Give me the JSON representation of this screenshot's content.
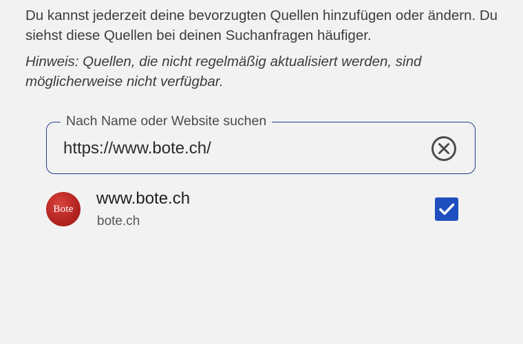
{
  "intro": {
    "description": "Du kannst jederzeit deine bevorzugten Quellen hinzufügen oder ändern. Du siehst diese Quellen bei deinen Suchanfragen häufiger.",
    "hint": "Hinweis: Quellen, die nicht regelmäßig aktualisiert werden, sind möglicherweise nicht verfügbar."
  },
  "search": {
    "label": "Nach Name oder Website suchen",
    "value": "https://www.bote.ch/",
    "clear_icon": "clear-circle-icon"
  },
  "results": [
    {
      "title": "www.bote.ch",
      "subtitle": "bote.ch",
      "logo_text": "Bote",
      "logo_color": "#b3231f",
      "checked": true
    }
  ],
  "colors": {
    "accent": "#1d3f8c",
    "checkbox": "#1f4fbf",
    "background": "#f2f2f2"
  }
}
